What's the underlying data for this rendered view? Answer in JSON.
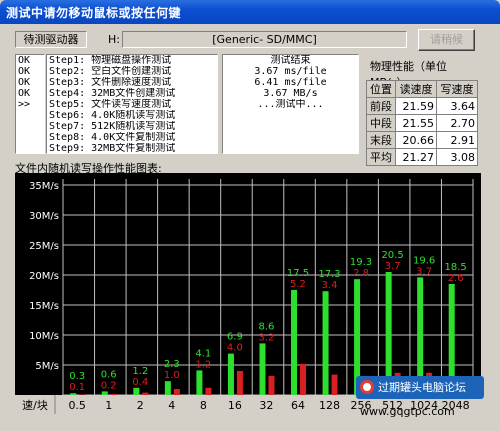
{
  "window": {
    "title": "测试中请勿移动鼠标或按任何键"
  },
  "drive": {
    "status_label": "待测驱动器",
    "letter": "H:",
    "name": "[Generic- SD/MMC]"
  },
  "button": {
    "label": "请稍候"
  },
  "steps": [
    {
      "status": "OK",
      "text": "Step1: 物理磁盘操作测试"
    },
    {
      "status": "OK",
      "text": "Step2: 空白文件创建测试"
    },
    {
      "status": "OK",
      "text": "Step3: 文件删除速度测试"
    },
    {
      "status": "OK",
      "text": "Step4: 32MB文件创建测试"
    },
    {
      "status": ">>",
      "text": "Step5: 文件读写速度测试"
    },
    {
      "status": "",
      "text": "Step6: 4.0K随机读写测试"
    },
    {
      "status": "",
      "text": "Step7: 512K随机读写测试"
    },
    {
      "status": "",
      "text": "Step8: 4.0K文件复制测试"
    },
    {
      "status": "",
      "text": "Step9: 32MB文件复制测试"
    }
  ],
  "results": [
    "测试结束",
    "3.67 ms/file",
    "6.41 ms/file",
    "3.67 MB/s",
    "...测试中..."
  ],
  "perf": {
    "title": "物理性能（单位MB/s）",
    "headers": [
      "位置",
      "读速度",
      "写速度"
    ],
    "rows": [
      {
        "pos": "前段",
        "read": "21.59",
        "write": "3.64"
      },
      {
        "pos": "中段",
        "read": "21.55",
        "write": "2.70"
      },
      {
        "pos": "末段",
        "read": "20.66",
        "write": "2.91"
      },
      {
        "pos": "平均",
        "read": "21.27",
        "write": "3.08"
      }
    ]
  },
  "chart_data": {
    "type": "bar",
    "title": "文件内随机读写操作性能图表:",
    "xlabel": "速/块",
    "categories": [
      "0.5",
      "1",
      "2",
      "4",
      "8",
      "16",
      "32",
      "64",
      "128",
      "256",
      "512",
      "1024",
      "2048"
    ],
    "ylim": [
      0,
      36
    ],
    "yticks": [
      "5M/s",
      "10M/s",
      "15M/s",
      "20M/s",
      "25M/s",
      "30M/s",
      "35M/s"
    ],
    "grid": true,
    "series": [
      {
        "name": "",
        "color": "#2ee02e",
        "values": [
          0.3,
          0.6,
          1.2,
          2.3,
          4.1,
          6.9,
          8.6,
          17.5,
          17.3,
          19.3,
          20.5,
          19.6,
          18.5
        ]
      },
      {
        "name": "",
        "color": "#d82020",
        "values": [
          0.1,
          0.2,
          0.4,
          1.0,
          1.2,
          4.0,
          3.2,
          5.2,
          3.4,
          2.8,
          3.7,
          3.7,
          2.6
        ]
      }
    ],
    "labels_read": [
      "0.3",
      "0.6",
      "1.2",
      "2.3",
      "4.1",
      "6.9",
      "8.6",
      "17.5",
      "17.3",
      "19.3",
      "20.5",
      "19.6",
      "18.5"
    ],
    "labels_write": [
      "0.1",
      "0.2",
      "0.4",
      "1.0",
      "1.2",
      "4.0",
      "3.2",
      "5.2",
      "3.4",
      "2.8",
      "3.7",
      "3.7",
      "2.6"
    ]
  },
  "watermark": {
    "text": "过期罐头电脑论坛",
    "url": "www.gqgtpc.com"
  }
}
